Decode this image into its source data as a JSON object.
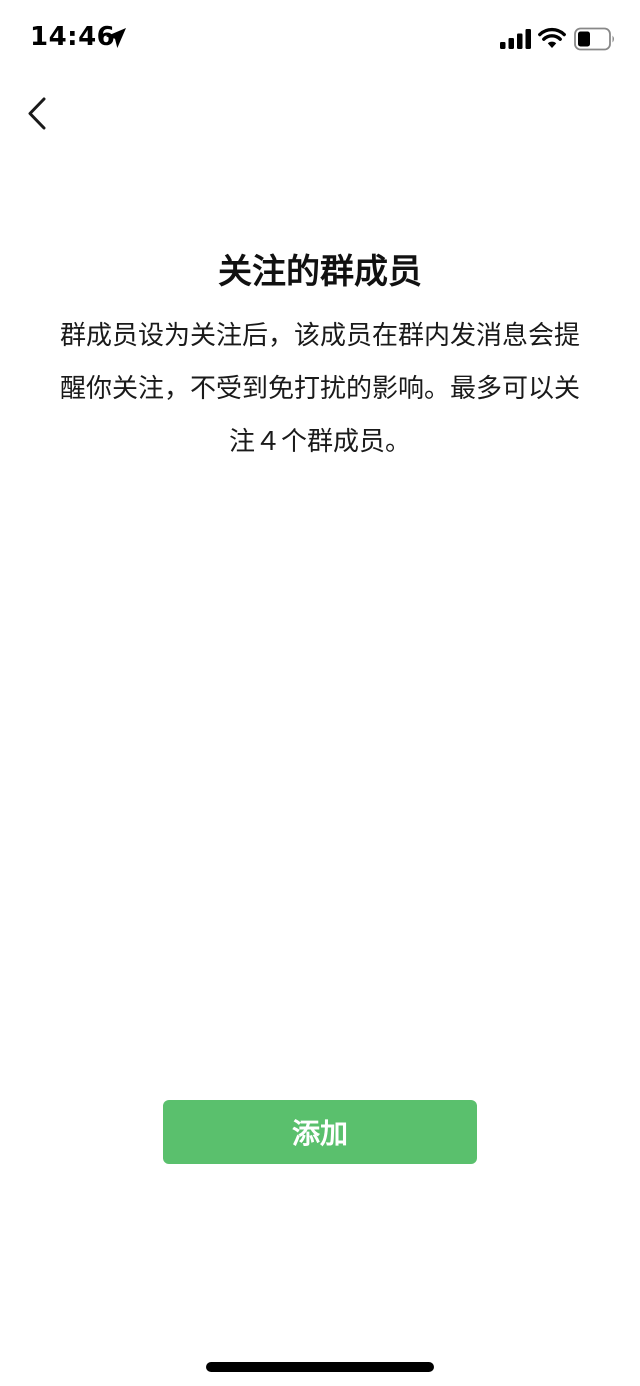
{
  "status_bar": {
    "time": "14:46",
    "icons": [
      "location-arrow-icon",
      "cellular-signal-icon",
      "wifi-icon",
      "battery-icon"
    ]
  },
  "nav": {
    "back_icon": "chevron-left-icon"
  },
  "main": {
    "title": "关注的群成员",
    "description": "群成员设为关注后，该成员在群内发消息会提醒你关注，不受到免打扰的影响。最多可以关注４个群成员。"
  },
  "actions": {
    "add_label": "添加"
  },
  "colors": {
    "primary_button": "#5ac06d",
    "background": "#ffffff",
    "text": "#1a1a1a"
  }
}
